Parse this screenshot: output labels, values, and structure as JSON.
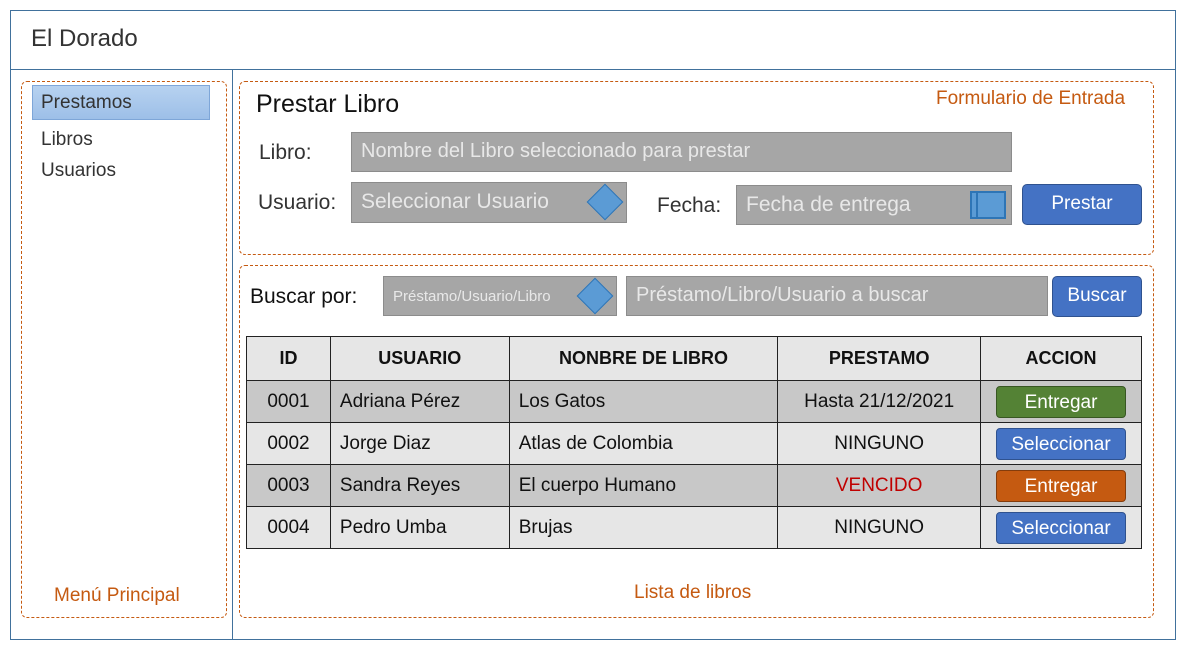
{
  "app": {
    "title": "El Dorado"
  },
  "sidebar": {
    "items": [
      {
        "label": "Prestamos",
        "active": true
      },
      {
        "label": "Libros"
      },
      {
        "label": "Usuarios"
      }
    ],
    "caption": "Menú Principal"
  },
  "form": {
    "title": "Prestar Libro",
    "caption": "Formulario de Entrada",
    "libro_label": "Libro:",
    "libro_placeholder": "Nombre del Libro seleccionado para prestar",
    "usuario_label": "Usuario:",
    "usuario_placeholder": "Seleccionar Usuario",
    "fecha_label": "Fecha:",
    "fecha_placeholder": "Fecha de entrega",
    "prestar_button": "Prestar"
  },
  "search": {
    "label": "Buscar por:",
    "type_value": "Préstamo/Usuario/Libro",
    "query_placeholder": "Préstamo/Libro/Usuario a buscar",
    "button": "Buscar"
  },
  "table": {
    "headers": [
      "ID",
      "USUARIO",
      "NONBRE DE LIBRO",
      "PRESTAMO",
      "ACCION"
    ],
    "rows": [
      {
        "id": "0001",
        "usuario": "Adriana Pérez",
        "libro": "Los Gatos",
        "prestamo": "Hasta 21/12/2021",
        "accion": "Entregar"
      },
      {
        "id": "0002",
        "usuario": "Jorge Diaz",
        "libro": "Atlas de Colombia",
        "prestamo": "NINGUNO",
        "accion": "Seleccionar"
      },
      {
        "id": "0003",
        "usuario": "Sandra Reyes",
        "libro": "El cuerpo Humano",
        "prestamo": "VENCIDO",
        "accion": "Entregar"
      },
      {
        "id": "0004",
        "usuario": "Pedro Umba",
        "libro": "Brujas",
        "prestamo": "NINGUNO",
        "accion": "Seleccionar"
      }
    ],
    "caption": "Lista de libros"
  },
  "colors": {
    "accent_blue": "#4472c4",
    "entregar_green": "#548235",
    "entregar_orange": "#c55a11",
    "overdue_red": "#c00000",
    "annotation_orange": "#c55a11"
  },
  "icons": {
    "usuario_dropdown": "diamond-dropdown-icon",
    "search_type_dropdown": "diamond-dropdown-icon",
    "date_picker": "calendar-icon"
  }
}
